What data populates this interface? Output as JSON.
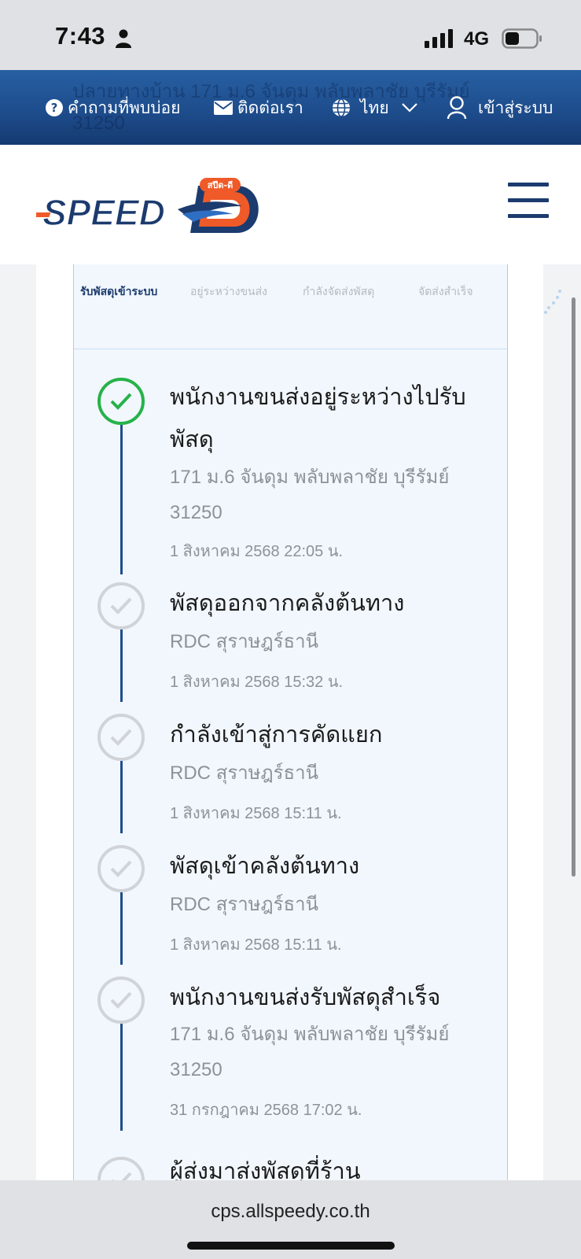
{
  "status_bar": {
    "time": "7:43",
    "network": "4G"
  },
  "top_nav": {
    "ghost_text": "ปลายทางบ้าน 171 ม.6 จันดุม พลับพลาชัย บุรีรัมย์ 31250",
    "faq": "คำถามที่พบบ่อย",
    "contact": "ติดต่อเรา",
    "language": "ไทย",
    "login": "เข้าสู่ระบบ"
  },
  "header": {
    "logo_text": "SPEED",
    "logo_letter": "D",
    "logo_badge": "สปีด-ดี"
  },
  "steps": {
    "items": [
      "รับพัสดุเข้าระบบ",
      "อยู่ระหว่างขนส่ง",
      "กำลังจัดส่งพัสดุ",
      "จัดส่งสำเร็จ"
    ],
    "active_index": 0
  },
  "timeline": [
    {
      "title": "พนักงานขนส่งอยู่ระหว่างไปรับพัสดุ",
      "location": "171 ม.6 จันดุม พลับพลาชัย บุรีรัมย์ 31250",
      "time": "1 สิงหาคม 2568 22:05 น.",
      "status": "current"
    },
    {
      "title": "พัสดุออกจากคลังต้นทาง",
      "location": "RDC สุราษฎร์ธานี",
      "time": "1 สิงหาคม 2568 15:32 น.",
      "status": "done"
    },
    {
      "title": "กำลังเข้าสู่การคัดแยก",
      "location": "RDC สุราษฎร์ธานี",
      "time": "1 สิงหาคม 2568 15:11 น.",
      "status": "done"
    },
    {
      "title": "พัสดุเข้าคลังต้นทาง",
      "location": "RDC สุราษฎร์ธานี",
      "time": "1 สิงหาคม 2568 15:11 น.",
      "status": "done"
    },
    {
      "title": "พนักงานขนส่งรับพัสดุสำเร็จ",
      "location": "171 ม.6 จันดุม พลับพลาชัย บุรีรัมย์ 31250",
      "time": "31 กรกฎาคม 2568 17:02 น.",
      "status": "done"
    },
    {
      "title": "ผู้ส่งมาส่งพัสดุที่ร้าน",
      "location": "",
      "time": "",
      "status": "done"
    }
  ],
  "browser": {
    "url": "cps.allspeedy.co.th"
  },
  "colors": {
    "nav_blue": "#1d4b8a",
    "brand_navy": "#1c3b6e",
    "success_green": "#27b24a",
    "brand_orange": "#f05a28"
  }
}
